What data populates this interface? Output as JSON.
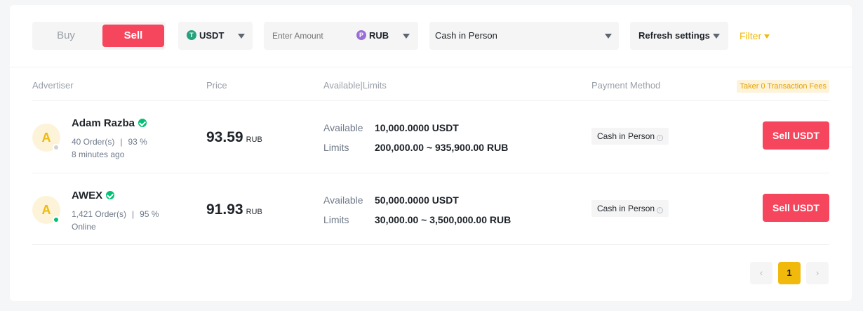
{
  "trade_toggle": {
    "buy_label": "Buy",
    "sell_label": "Sell"
  },
  "filters": {
    "asset": {
      "icon_letter": "T",
      "value": "USDT",
      "icon_color": "#26a17b"
    },
    "amount": {
      "placeholder": "Enter Amount",
      "currency": "RUB",
      "currency_icon_letter": "P",
      "currency_icon_color": "#9b6dd6"
    },
    "payment": {
      "value": "Cash in Person"
    },
    "refresh": {
      "label": "Refresh settings"
    },
    "filter_link": {
      "label": "Filter"
    }
  },
  "table": {
    "headers": {
      "advertiser": "Advertiser",
      "price": "Price",
      "available": "Available|Limits",
      "payment": "Payment Method",
      "taker_badge": "Taker 0 Transaction Fees"
    },
    "rows": [
      {
        "avatar_letter": "A",
        "status_color": "#cfd3d8",
        "name": "Adam Razba",
        "orders": "40 Order(s)",
        "separator": "|",
        "completion": "93 %",
        "status_text": "8 minutes ago",
        "price": "93.59",
        "price_currency": "RUB",
        "available_label": "Available",
        "available_value": "10,000.0000 USDT",
        "limits_label": "Limits",
        "limits_value": "200,000.00 ~ 935,900.00 RUB",
        "payment_method": "Cash in Person",
        "info_glyph": "i",
        "action_label": "Sell USDT"
      },
      {
        "avatar_letter": "A",
        "status_color": "#02c076",
        "name": "AWEX",
        "orders": "1,421 Order(s)",
        "separator": "|",
        "completion": "95 %",
        "status_text": "Online",
        "price": "91.93",
        "price_currency": "RUB",
        "available_label": "Available",
        "available_value": "50,000.0000 USDT",
        "limits_label": "Limits",
        "limits_value": "30,000.00 ~ 3,500,000.00 RUB",
        "payment_method": "Cash in Person",
        "info_glyph": "i",
        "action_label": "Sell USDT"
      }
    ]
  },
  "pagination": {
    "prev": "‹",
    "current": "1",
    "next": "›"
  },
  "colors": {
    "accent": "#f0b90b",
    "sell": "#f6465d",
    "verified": "#02c076"
  }
}
